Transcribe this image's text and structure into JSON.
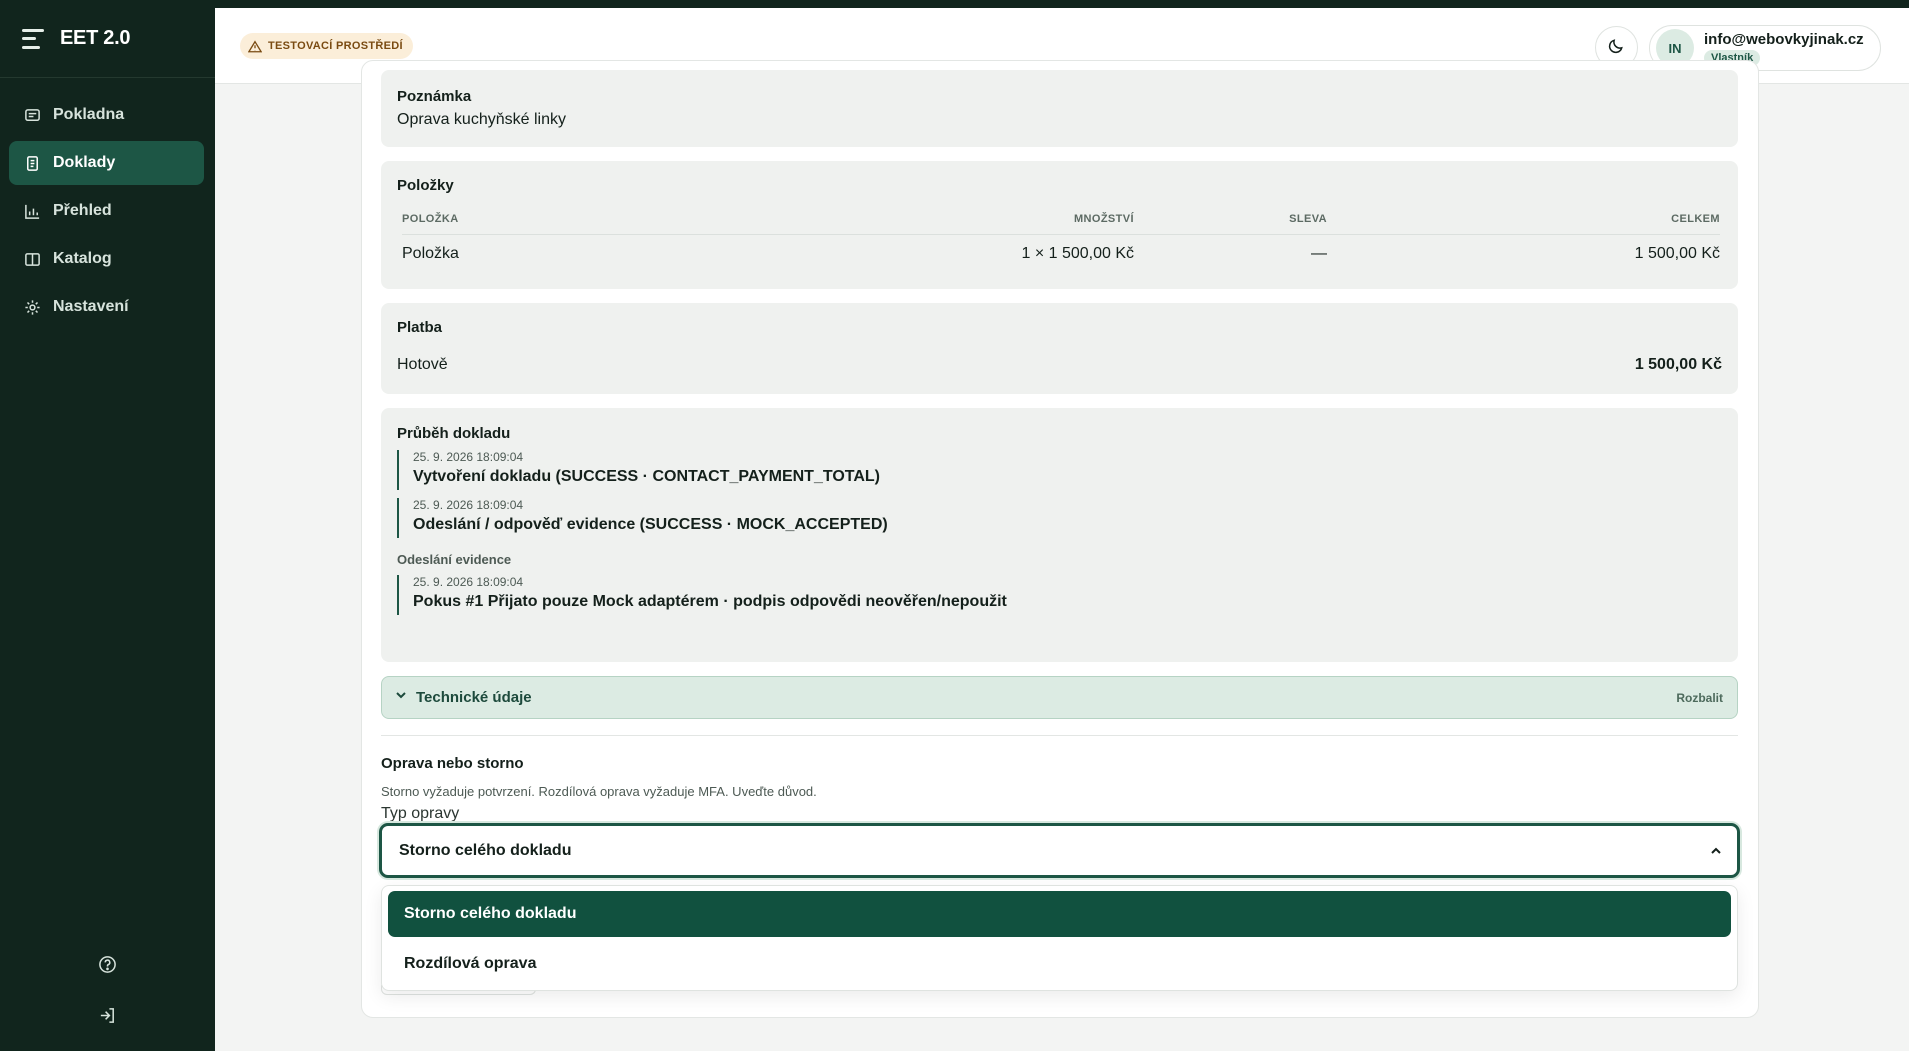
{
  "app": {
    "name": "EET 2.0"
  },
  "sidebar": {
    "items": [
      {
        "label": "Pokladna",
        "icon": "receipt-icon"
      },
      {
        "label": "Doklady",
        "icon": "document-icon",
        "active": true
      },
      {
        "label": "Přehled",
        "icon": "chart-icon"
      },
      {
        "label": "Katalog",
        "icon": "book-icon"
      },
      {
        "label": "Nastavení",
        "icon": "gear-icon"
      }
    ],
    "help_icon": "help-icon",
    "logout_icon": "logout-icon"
  },
  "header": {
    "env_badge": "TESTOVACÍ PROSTŘEDÍ",
    "theme_icon": "moon-icon",
    "user": {
      "initials": "IN",
      "email": "info@webovkyjinak.cz",
      "role": "Vlastník"
    }
  },
  "note": {
    "title": "Poznámka",
    "text": "Oprava kuchyňské linky"
  },
  "items": {
    "title": "Položky",
    "columns": [
      "POLOŽKA",
      "MNOŽSTVÍ",
      "SLEVA",
      "CELKEM"
    ],
    "rows": [
      {
        "name": "Položka",
        "qty": "1 × 1 500,00 Kč",
        "discount": "—",
        "total": "1 500,00 Kč"
      }
    ]
  },
  "payment": {
    "title": "Platba",
    "method": "Hotově",
    "amount": "1 500,00 Kč"
  },
  "timeline": {
    "title": "Průběh dokladu",
    "entries": [
      {
        "time": "25. 9. 2026 18:09:04",
        "text": "Vytvoření dokladu (SUCCESS · CONTACT_PAYMENT_TOTAL)"
      },
      {
        "time": "25. 9. 2026 18:09:04",
        "text": "Odeslání / odpověď evidence (SUCCESS · MOCK_ACCEPTED)"
      }
    ],
    "group_label": "Odeslání evidence",
    "group_entries": [
      {
        "time": "25. 9. 2026 18:09:04",
        "text": "Pokus #1 Přijato pouze Mock adaptérem · podpis odpovědi neověřen/nepoužit"
      }
    ]
  },
  "tech": {
    "title": "Technické údaje",
    "action": "Rozbalit"
  },
  "correction": {
    "title": "Oprava nebo storno",
    "help": "Storno vyžaduje potvrzení. Rozdílová oprava vyžaduje MFA. Uveďte důvod.",
    "type_label": "Typ opravy",
    "selected": "Storno celého dokladu",
    "options": [
      "Storno celého dokladu",
      "Rozdílová oprava"
    ]
  },
  "colors": {
    "sidebar_bg": "#11251d",
    "accent": "#1d5645",
    "env_badge_bg": "#fbeed9"
  }
}
